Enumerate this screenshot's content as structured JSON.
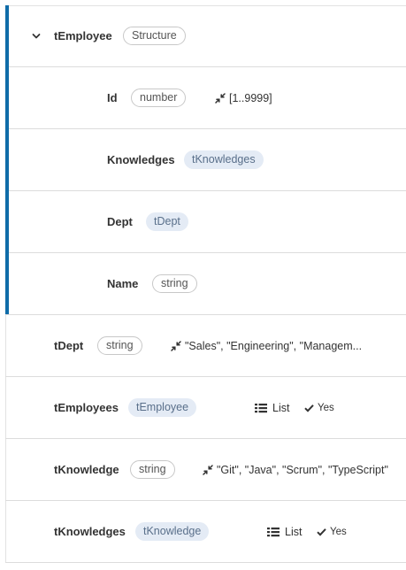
{
  "tree": {
    "root": {
      "name": "tEmployee",
      "type": "Structure",
      "expanded": true,
      "fields": [
        {
          "name": "Id",
          "type": "number",
          "type_style": "outline",
          "constraint": "[1..9999]"
        },
        {
          "name": "Knowledges",
          "type": "tKnowledges",
          "type_style": "reference"
        },
        {
          "name": "Dept",
          "type": "tDept",
          "type_style": "reference"
        },
        {
          "name": "Name",
          "type": "string",
          "type_style": "outline"
        }
      ]
    },
    "types": [
      {
        "name": "tDept",
        "type": "string",
        "type_style": "outline",
        "constraint": "\"Sales\", \"Engineering\", \"Managem..."
      },
      {
        "name": "tEmployees",
        "type": "tEmployee",
        "type_style": "reference",
        "list_label": "List",
        "list_flag": "Yes"
      },
      {
        "name": "tKnowledge",
        "type": "string",
        "type_style": "outline",
        "constraint": "\"Git\", \"Java\", \"Scrum\", \"TypeScript\""
      },
      {
        "name": "tKnowledges",
        "type": "tKnowledge",
        "type_style": "reference",
        "list_label": "List",
        "list_flag": "Yes"
      }
    ]
  },
  "colors": {
    "selection_accent": "#0f6ca8",
    "reference_pill_bg": "#e4ebf5",
    "reference_pill_text": "#596f8a",
    "outline_pill_border": "#c8c8c8"
  },
  "icons": {
    "expand": "chevron-down-icon",
    "constraint": "compress-arrows-icon",
    "list": "list-icon",
    "flag": "check-icon"
  }
}
